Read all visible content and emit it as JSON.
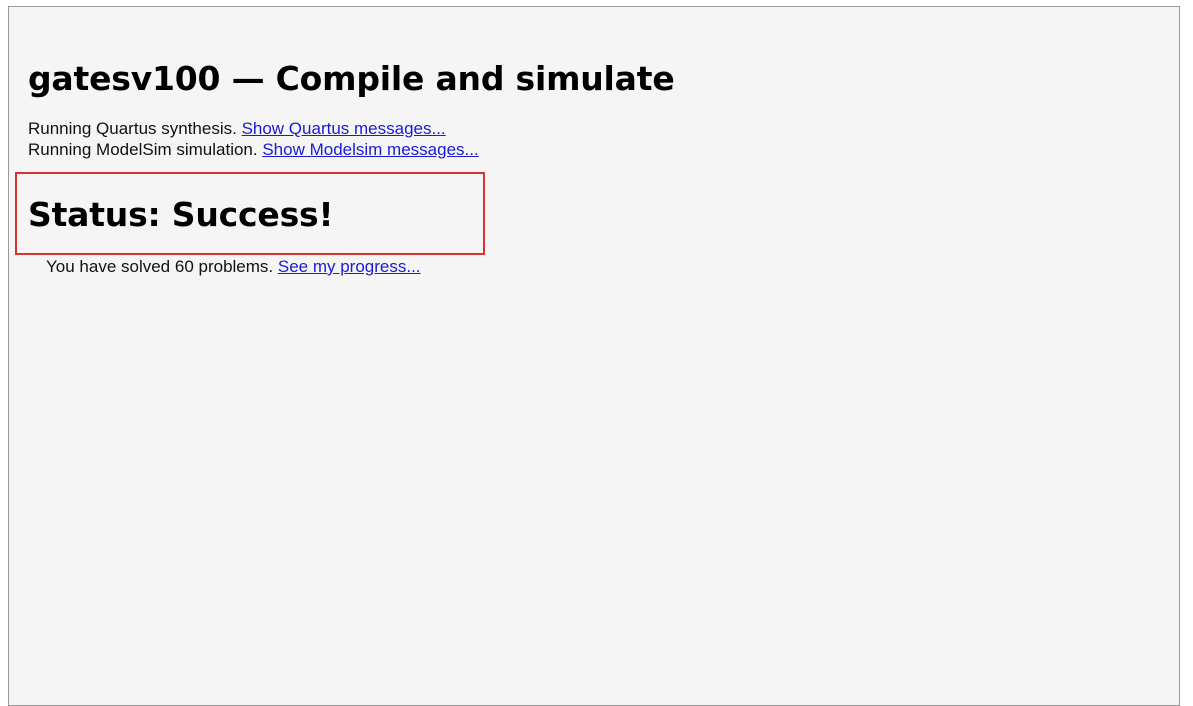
{
  "page": {
    "title": "gatesv100 — Compile and simulate"
  },
  "log": {
    "quartus_text": "Running Quartus synthesis. ",
    "quartus_link": "Show Quartus messages...",
    "modelsim_text": "Running ModelSim simulation. ",
    "modelsim_link": "Show Modelsim messages..."
  },
  "status": {
    "title": "Status: Success!",
    "highlight_color": "#d93030"
  },
  "progress": {
    "text": "You have solved 60 problems. ",
    "link": "See my progress..."
  }
}
